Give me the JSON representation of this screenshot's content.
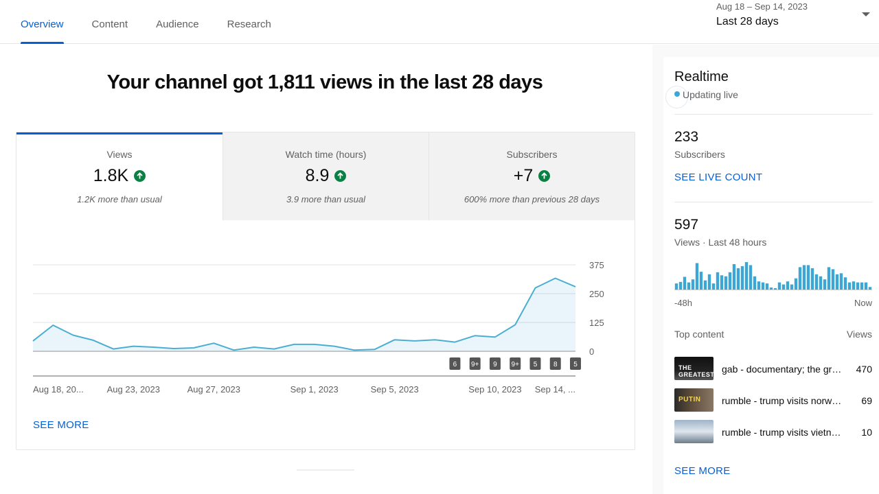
{
  "tabs": [
    "Overview",
    "Content",
    "Audience",
    "Research"
  ],
  "date_range": {
    "sub": "Aug 18 – Sep 14, 2023",
    "main": "Last 28 days"
  },
  "headline": "Your channel got 1,811 views in the last 28 days",
  "metrics": [
    {
      "label": "Views",
      "value": "1.8K",
      "note": "1.2K more than usual"
    },
    {
      "label": "Watch time (hours)",
      "value": "8.9",
      "note": "3.9 more than usual"
    },
    {
      "label": "Subscribers",
      "value": "+7",
      "note": "600% more than previous 28 days"
    }
  ],
  "chart_data": {
    "type": "area",
    "series": [
      {
        "values": [
          45,
          113,
          70,
          48,
          10,
          22,
          18,
          12,
          15,
          35,
          5,
          18,
          10,
          30,
          30,
          22,
          5,
          8,
          50,
          45,
          50,
          40,
          68,
          62,
          115,
          275,
          317,
          280
        ]
      }
    ],
    "ylim": [
      0,
      375
    ],
    "y_ticks": [
      "375",
      "250",
      "125",
      "0"
    ],
    "x_tick_labels": [
      "Aug 18, 20...",
      "Aug 23, 2023",
      "Aug 27, 2023",
      "Sep 1, 2023",
      "Sep 5, 2023",
      "Sep 10, 2023",
      "Sep 14, ..."
    ],
    "x_tick_days": [
      0,
      5,
      9,
      14,
      18,
      23,
      27
    ],
    "markers": [
      {
        "day": 21,
        "label": "6"
      },
      {
        "day": 22,
        "label": "9+"
      },
      {
        "day": 23,
        "label": "9"
      },
      {
        "day": 24,
        "label": "9+"
      },
      {
        "day": 25,
        "label": "5"
      },
      {
        "day": 26,
        "label": "8"
      },
      {
        "day": 27,
        "label": "5"
      }
    ],
    "grid": true,
    "color": "#4aaed2"
  },
  "see_more": "SEE MORE",
  "realtime": {
    "title": "Realtime",
    "status": "Updating live",
    "subscribers": {
      "value": "233",
      "label": "Subscribers",
      "link": "SEE LIVE COUNT"
    },
    "views": {
      "value": "597",
      "label": "Views · Last 48 hours"
    },
    "bars": [
      12,
      15,
      25,
      14,
      20,
      52,
      35,
      18,
      30,
      12,
      34,
      28,
      26,
      34,
      50,
      42,
      46,
      54,
      48,
      26,
      16,
      14,
      12,
      4,
      0,
      14,
      10,
      16,
      10,
      22,
      44,
      48,
      48,
      42,
      30,
      26,
      20,
      44,
      40,
      30,
      32,
      24,
      14,
      16,
      14,
      14,
      14,
      5
    ],
    "axis_left": "-48h",
    "axis_right": "Now",
    "top_content_label": "Top content",
    "views_col": "Views",
    "top_content": [
      {
        "title": "gab - documentary; the gre...",
        "views": "470",
        "thumb_text": "THE GREATEST"
      },
      {
        "title": "rumble - trump visits norway...",
        "views": "69",
        "thumb_text": "PUTIN"
      },
      {
        "title": "rumble - trump visits vietna...",
        "views": "10",
        "thumb_text": ""
      }
    ],
    "see_more": "SEE MORE"
  }
}
